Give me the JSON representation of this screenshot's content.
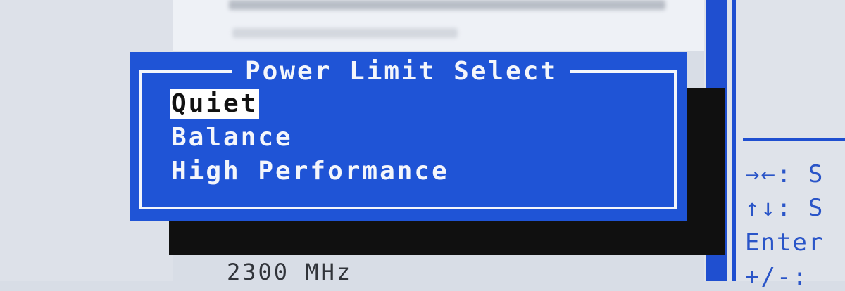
{
  "dialog": {
    "title": "Power Limit Select",
    "options": [
      {
        "label": "Quiet",
        "selected": true
      },
      {
        "label": "Balance",
        "selected": false
      },
      {
        "label": "High Performance",
        "selected": false
      }
    ]
  },
  "background": {
    "value_text": "2300 MHz",
    "help": [
      {
        "keys": "→←",
        "text": ": S"
      },
      {
        "keys": "↑↓",
        "text": ": S"
      },
      {
        "keys": "Enter",
        "text": ""
      },
      {
        "keys": "+/-",
        "text": ":"
      }
    ]
  },
  "colors": {
    "dialog_blue": "#1f54d6",
    "frame_white": "#f4f6fb",
    "selection_bg": "#ffffff",
    "selection_fg": "#111111"
  }
}
